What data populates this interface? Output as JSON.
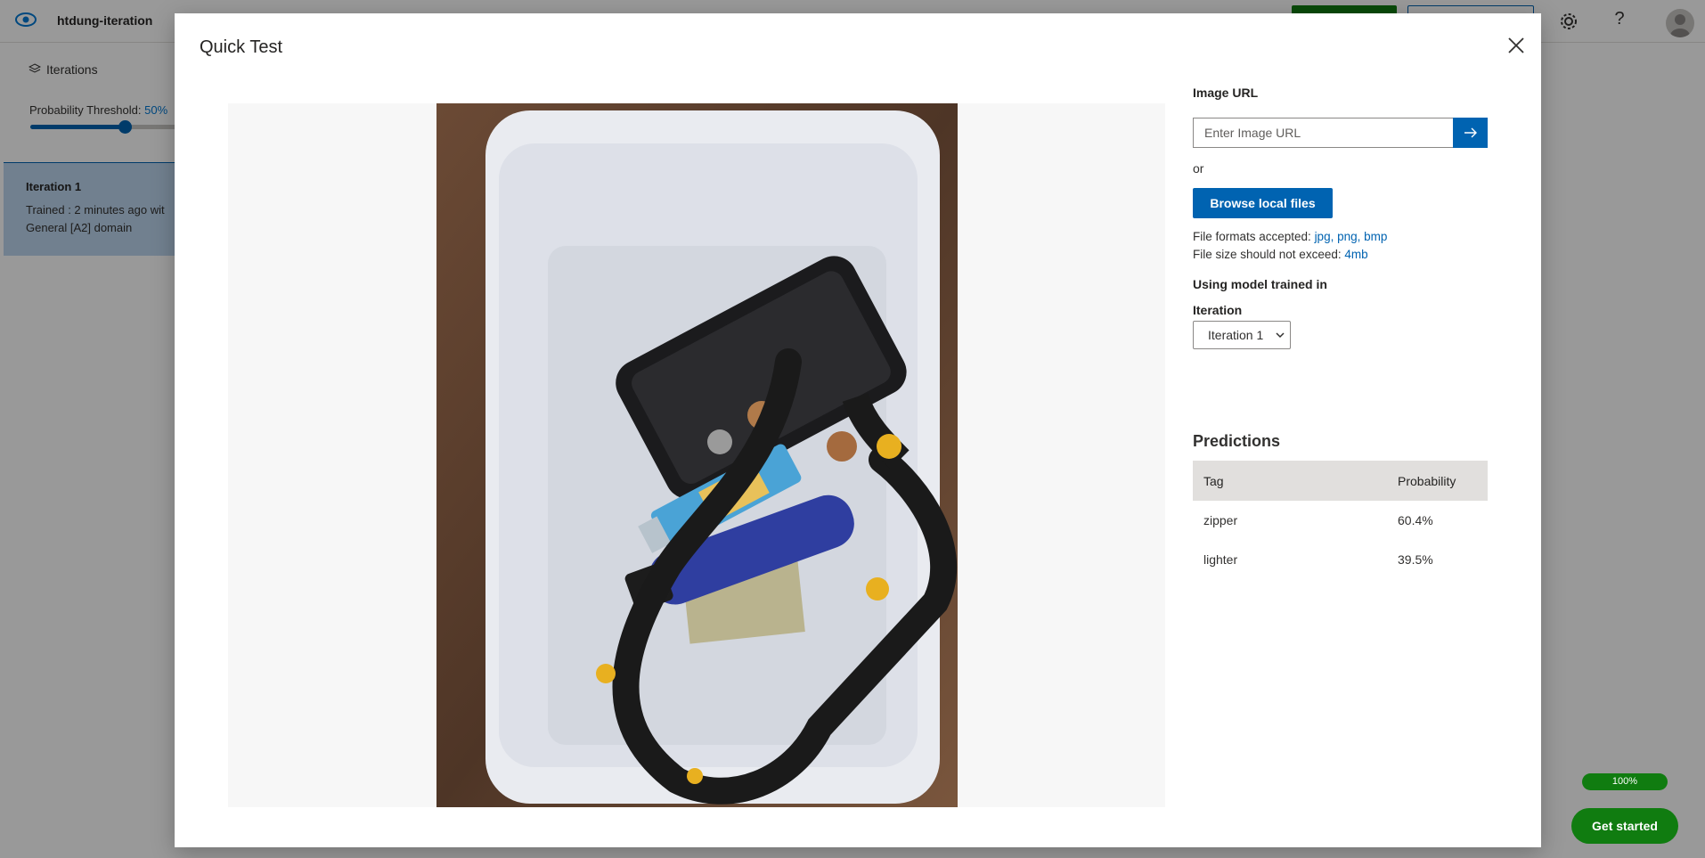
{
  "background": {
    "project_name": "htdung-iteration",
    "sidebar": {
      "iterations_label": "Iterations",
      "threshold_label": "Probability Threshold: ",
      "threshold_value": "50%",
      "iteration_card": {
        "title": "Iteration 1",
        "line1": "Trained : 2 minutes ago wit",
        "line2": "General [A2] domain"
      }
    },
    "progress_label": "100%",
    "get_started_label": "Get started"
  },
  "modal": {
    "title": "Quick Test",
    "image_url_label": "Image URL",
    "image_url_placeholder": "Enter Image URL",
    "image_url_value": "",
    "or_label": "or",
    "browse_label": "Browse local files",
    "formats_prefix": "File formats accepted: ",
    "formats_value": "jpg, png, bmp",
    "size_prefix": "File size should not exceed: ",
    "size_value": "4mb",
    "model_label": "Using model trained in",
    "iteration_label": "Iteration",
    "iteration_selected": "Iteration 1",
    "predictions": {
      "title": "Predictions",
      "columns": [
        "Tag",
        "Probability"
      ],
      "rows": [
        {
          "tag": "zipper",
          "probability": "60.4%"
        },
        {
          "tag": "lighter",
          "probability": "39.5%"
        }
      ]
    }
  },
  "colors": {
    "accent_blue": "#0063b1",
    "green": "#107c10"
  }
}
